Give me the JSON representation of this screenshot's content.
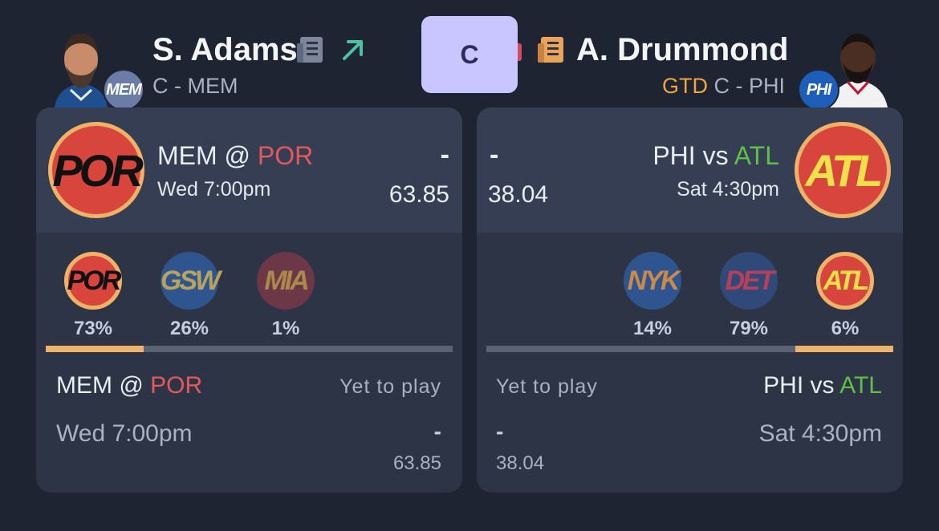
{
  "header": {
    "left_player": {
      "name": "S. Adams",
      "sub": "C - MEM",
      "team_badge": "MEM",
      "trend_icon": "arrow-up-right-icon",
      "news_icon": "news-icon"
    },
    "position_button": "C",
    "right_player": {
      "name": "A. Drummond",
      "status": "GTD",
      "sub": "C - PHI",
      "team_badge": "PHI",
      "news_icon": "news-icon"
    }
  },
  "left_card": {
    "logo": "POR",
    "matchup_team": "MEM @",
    "matchup_opp": "POR",
    "time": "Wed 7:00pm",
    "dash": "-",
    "score": "63.85",
    "opponents": [
      {
        "abbr": "POR",
        "pct": "73%",
        "selected": true
      },
      {
        "abbr": "GSW",
        "pct": "26%",
        "selected": false
      },
      {
        "abbr": "MIA",
        "pct": "1%",
        "selected": false
      }
    ],
    "bar_fill": 0.24,
    "detail": {
      "matchup_team": "MEM @",
      "matchup_opp": "POR",
      "status": "Yet to play",
      "time": "Wed 7:00pm",
      "dash": "-",
      "score": "63.85"
    }
  },
  "right_card": {
    "logo": "ATL",
    "matchup_team": "PHI vs",
    "matchup_opp": "ATL",
    "time": "Sat 4:30pm",
    "dash": "-",
    "score": "38.04",
    "opponents": [
      {
        "abbr": "NYK",
        "pct": "14%",
        "selected": false
      },
      {
        "abbr": "DET",
        "pct": "79%",
        "selected": false
      },
      {
        "abbr": "ATL",
        "pct": "6%",
        "selected": true
      }
    ],
    "bar_fill": 0.24,
    "detail": {
      "matchup_team": "PHI vs",
      "matchup_opp": "ATL",
      "status": "Yet to play",
      "time": "Sat 4:30pm",
      "dash": "-",
      "score": "38.04"
    }
  },
  "colors": {
    "accent": "#f0b267",
    "pos_bg": "#c9c6ff",
    "gtd": "#f0a63c",
    "red": "#e5585c",
    "green": "#5fbf47"
  }
}
